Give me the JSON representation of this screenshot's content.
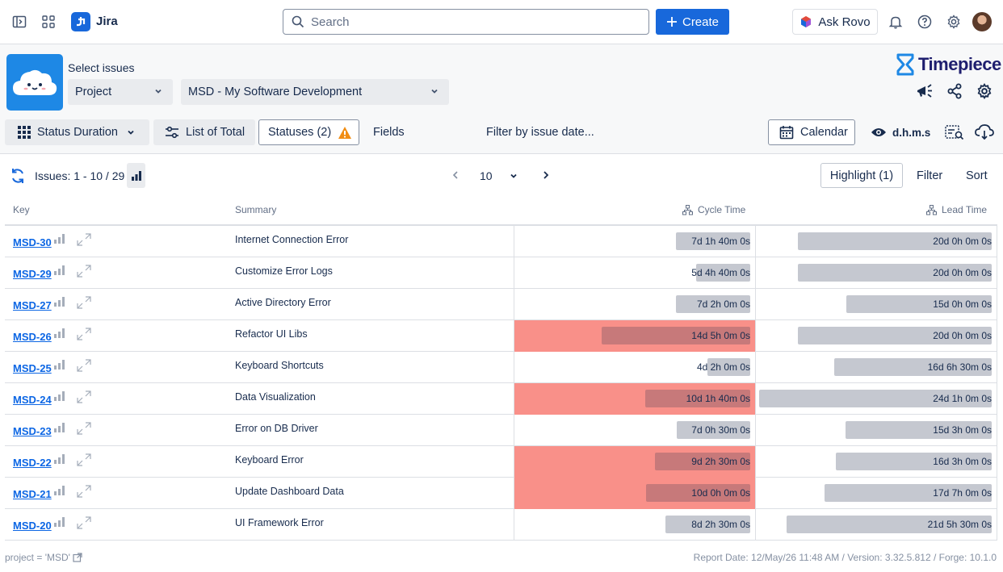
{
  "topbar": {
    "app_name": "Jira",
    "search_placeholder": "Search",
    "create_label": "Create",
    "rovo_label": "Ask Rovo"
  },
  "header": {
    "select_label": "Select issues",
    "scope_select": "Project",
    "project_select": "MSD - My Software Development",
    "brand": "Timepiece"
  },
  "toolbar": {
    "report_type": "Status Duration",
    "list_of_total": "List of Total",
    "statuses": "Statuses (2)",
    "fields": "Fields",
    "date_filter": "Filter by issue date...",
    "calendar": "Calendar",
    "time_format": "d.h.m.s"
  },
  "list": {
    "issues_count": "Issues: 1 - 10 / 29",
    "page_size": "10",
    "highlight": "Highlight (1)",
    "filter": "Filter",
    "sort": "Sort"
  },
  "columns": {
    "key": "Key",
    "summary": "Summary",
    "cycle": "Cycle Time",
    "lead": "Lead Time"
  },
  "rows": [
    {
      "key": "MSD-30",
      "summary": "Internet Connection Error",
      "cycle": "7d 1h 40m 0s",
      "cycle_days": 7.07,
      "lead": "20d 0h 0m 0s",
      "lead_days": 20.0,
      "highlight": false
    },
    {
      "key": "MSD-29",
      "summary": "Customize Error Logs",
      "cycle": "5d 4h 40m 0s",
      "cycle_days": 5.19,
      "lead": "20d 0h 0m 0s",
      "lead_days": 20.0,
      "highlight": false
    },
    {
      "key": "MSD-27",
      "summary": "Active Directory Error",
      "cycle": "7d 2h 0m 0s",
      "cycle_days": 7.08,
      "lead": "15d 0h 0m 0s",
      "lead_days": 15.0,
      "highlight": false
    },
    {
      "key": "MSD-26",
      "summary": "Refactor UI Libs",
      "cycle": "14d 5h 0m 0s",
      "cycle_days": 14.21,
      "lead": "20d 0h 0m 0s",
      "lead_days": 20.0,
      "highlight": true
    },
    {
      "key": "MSD-25",
      "summary": "Keyboard Shortcuts",
      "cycle": "4d 2h 0m 0s",
      "cycle_days": 4.08,
      "lead": "16d 6h 30m 0s",
      "lead_days": 16.27,
      "highlight": false
    },
    {
      "key": "MSD-24",
      "summary": "Data Visualization",
      "cycle": "10d 1h 40m 0s",
      "cycle_days": 10.07,
      "lead": "24d 1h 0m 0s",
      "lead_days": 24.04,
      "highlight": true
    },
    {
      "key": "MSD-23",
      "summary": "Error on DB Driver",
      "cycle": "7d 0h 30m 0s",
      "cycle_days": 7.02,
      "lead": "15d 3h 0m 0s",
      "lead_days": 15.13,
      "highlight": false
    },
    {
      "key": "MSD-22",
      "summary": "Keyboard Error",
      "cycle": "9d 2h 30m 0s",
      "cycle_days": 9.1,
      "lead": "16d 3h 0m 0s",
      "lead_days": 16.13,
      "highlight": true
    },
    {
      "key": "MSD-21",
      "summary": "Update Dashboard Data",
      "cycle": "10d 0h 0m 0s",
      "cycle_days": 10.0,
      "lead": "17d 7h 0m 0s",
      "lead_days": 17.29,
      "highlight": true
    },
    {
      "key": "MSD-20",
      "summary": "UI Framework Error",
      "cycle": "8d 2h 30m 0s",
      "cycle_days": 8.1,
      "lead": "21d 5h 30m 0s",
      "lead_days": 21.23,
      "highlight": false
    }
  ],
  "footer": {
    "jql": "project = 'MSD'",
    "report_info": "Report Date: 12/May/26 11:48 AM / Version: 3.32.5.812 / Forge: 10.1.0"
  },
  "colors": {
    "primary": "#1868db",
    "highlight_cell": "#f99089",
    "bar": "#c5c8d0",
    "bar_highlight": "#c7797a",
    "link": "#0c66e4",
    "warning": "#f18d13"
  }
}
